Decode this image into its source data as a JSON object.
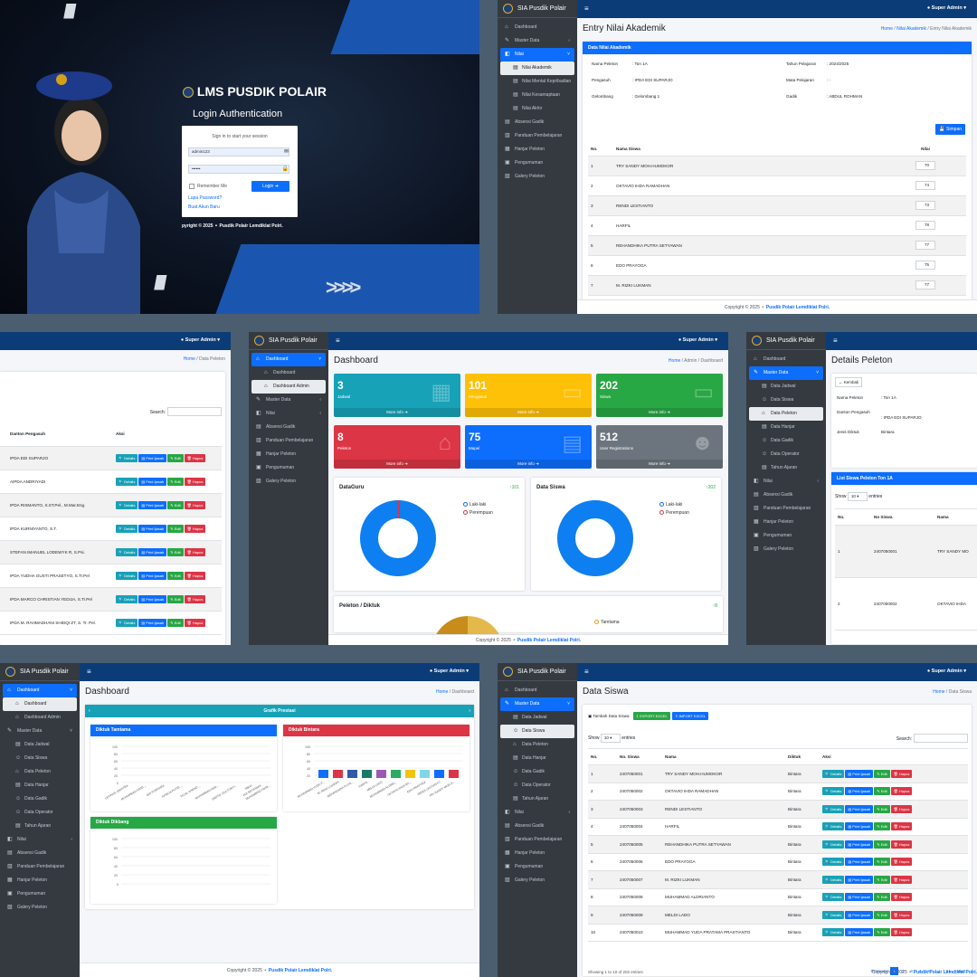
{
  "login": {
    "brand": "LMS PUSDIK POLAIR",
    "title": "Login Authentication",
    "prompt": "Sign in to start your session",
    "username": "admin123",
    "password": "••••••",
    "remember": "Remember Me",
    "login_btn": "Login",
    "forgot": "Lupa Password?",
    "register": "Buat Akun Baru",
    "copyright": "pyright © 2025 ⚬ Pusdik Polair Lemdiklat Polri."
  },
  "common": {
    "brand": "SIA Pusdik Polair",
    "user": "Super Admin",
    "home": "Home",
    "footer_pre": "Copyright © 2025 ⚬ ",
    "footer_org": "Pusdik Polair Lemdiklat Polri.",
    "search": "Search:",
    "show": "Show",
    "entries": "entries"
  },
  "entry": {
    "title": "Entry Nilai Akademik",
    "crumb_mid": "Nilai Akademik",
    "crumb_cur": "Entry Nilai Akademik",
    "header": "Data Nilai Akademik",
    "info": [
      [
        "Nama Peleton",
        ": Ton 1A",
        "Tahun Pelajaran",
        ": 2024/2025"
      ],
      [
        "Pengasuh",
        ": IPDA EDI SUPARJO",
        "Mata Pelajaran",
        ": -"
      ],
      [
        "Gelombang",
        ": Gelombang 1",
        "Gadik",
        ": ABDUL ROHMAN"
      ]
    ],
    "save": "Simpan",
    "cols": [
      "No.",
      "Nama Siswa",
      "Nilai"
    ],
    "rows": [
      [
        "1",
        "TRY SANDY MOH.HUMOKOR",
        "70"
      ],
      [
        "2",
        "OKTAVIO IHDA RAMADHAN",
        "74"
      ],
      [
        "3",
        "RENDI LESTIANTO",
        "73"
      ],
      [
        "4",
        "HARFIL",
        "78"
      ],
      [
        "5",
        "REHANDHIKA PUTRA SETYAWAN",
        "77"
      ],
      [
        "6",
        "EDO PRAYOGA",
        "75"
      ],
      [
        "7",
        "M. RIZKI LUKMAN",
        "77"
      ]
    ],
    "menu": [
      "Dashboard",
      "Master Data",
      "Nilai",
      "Nilai Akademik",
      "Nilai Mental Kepribadian",
      "Nilai Kesamaptaan",
      "Nilai Akhir",
      "Absensi Gadik",
      "Panduan Pembelajaran",
      "Hanjar Peleton",
      "Pengumuman",
      "Galery Peleton"
    ]
  },
  "peleton": {
    "crumb_cur": "Data Peleton",
    "col": "Danton Pengasuh",
    "aksi": "Aksi",
    "rows": [
      "IPDA EDI SUPARJO",
      "AIPDA ANDRIYADI",
      "IPDA RISMANTO, S.ST.Pel., M.Mar.Eng.",
      "IPDA KURNIYANTO, S.T.",
      "STEFAN IMANUEL LODEWYK R, S.Psi.",
      "IPDA YUDHA GUSTI PRASETYO, S.Tr.Pel",
      "IPDA MARCO CHRISTIAN YEDIJA, S.Tr.Pel",
      "IPDA M. RAHMADHANI SHIDQI ZT, S. Tr. Pel."
    ],
    "btns": [
      "Details",
      "Print Ijasah",
      "Edit",
      "Hapus"
    ]
  },
  "dash": {
    "title": "Dashboard",
    "crumb_mid": "Admin",
    "crumb_cur": "Dashboard",
    "menu": [
      "Dashboard",
      "Dashboard",
      "Dashboard Admin",
      "Master Data",
      "Nilai",
      "Absensi Gadik",
      "Panduan Pembelajaran",
      "Hanjar Peleton",
      "Pengumuman",
      "Galery Peleton"
    ],
    "boxes": [
      {
        "n": "3",
        "l": "Jadwal",
        "c": "#17a2b8"
      },
      {
        "n": "101",
        "l": "Pengasuh",
        "c": "#ffc107"
      },
      {
        "n": "202",
        "l": "Siswa",
        "c": "#28a745"
      },
      {
        "n": "8",
        "l": "Peleton",
        "c": "#dc3545"
      },
      {
        "n": "75",
        "l": "Mapel",
        "c": "#0d6efd"
      },
      {
        "n": "512",
        "l": "User Registrations",
        "c": "#6c757d"
      }
    ],
    "more": "More info",
    "guru": {
      "title": "DataGuru",
      "count": "101",
      "l1": "Laki-laki",
      "l2": "Perempuan"
    },
    "siswa": {
      "title": "Data Siswa",
      "count": "202",
      "l1": "Laki-laki",
      "l2": "Perempuan"
    },
    "pel": {
      "title": "Peleton / Diktuk",
      "count": "8",
      "l1": "Tamtama"
    }
  },
  "detail": {
    "title": "Details Peleton",
    "back": "Kembali",
    "info": [
      [
        "Nama Peleton",
        ": Ton 1A"
      ],
      [
        "Danton Pengasuh",
        ": IPDA EDI SUPARJO"
      ],
      [
        "Jenis Diktuk",
        "Bintara"
      ]
    ],
    "list": "List Siswa Peleton Ton 1A",
    "cols": [
      "No.",
      "No Siswa",
      "Nama"
    ],
    "rows": [
      [
        "1",
        "2407050001",
        "TRY SANDY MO"
      ],
      [
        "2",
        "2407050002",
        "OKTAVIO IHDA"
      ]
    ],
    "menu": [
      "Dashboard",
      "Master Data",
      "Data Jadwal",
      "Data Siswa",
      "Data Peleton",
      "Data Hanjar",
      "Data Gadik",
      "Data Operator",
      "Tahun Ajaran",
      "Nilai",
      "Absensi Gadik",
      "Panduan Pembelajaran",
      "Hanjar Peleton",
      "Pengumuman",
      "Galery Peleton"
    ]
  },
  "dash2": {
    "title": "Dashboard",
    "crumb_cur": "Dashboard",
    "grafik": "Grafik Prestasi",
    "c1": "Diktuk Tamtama",
    "c2": "Diktuk Bintara",
    "c3": "Diktuk Dikbang",
    "menu": [
      "Dashboard",
      "Dashboard",
      "Dashboard Admin",
      "Master Data",
      "Data Jadwal",
      "Data Siswa",
      "Data Peleton",
      "Data Hanjar",
      "Data Gadik",
      "Data Operator",
      "Tahun Ajaran",
      "Nilai",
      "Absensi Gadik",
      "Panduan Pembelajaran",
      "Hanjar Peleton",
      "Pengumuman",
      "Galery Peleton"
    ]
  },
  "siswa": {
    "title": "Data Siswa",
    "crumb_cur": "Data Siswa",
    "add": "Tambah Data Siswa",
    "export": "EXPORT EXCEL",
    "import": "IMPORT EXCEL",
    "cols": [
      "No.",
      "No. Siswa",
      "Nama",
      "Diktuk",
      "Aksi"
    ],
    "rows": [
      [
        "1",
        "2407050001",
        "TRY SANDY MOH.HUMOKOR",
        "Bintara"
      ],
      [
        "2",
        "2407050002",
        "OKTAVIO IHDA RAMADHAN",
        "Bintara"
      ],
      [
        "3",
        "2407050003",
        "RENDI LESTIANTO",
        "Bintara"
      ],
      [
        "4",
        "2407050004",
        "HARFIL",
        "Bintara"
      ],
      [
        "5",
        "2407050005",
        "REHANDHIKA PUTRA SETYAWAN",
        "Bintara"
      ],
      [
        "6",
        "2407050006",
        "EDO PRAYOGA",
        "Bintara"
      ],
      [
        "7",
        "2407050007",
        "M. RIZKI LUKMAN",
        "Bintara"
      ],
      [
        "8",
        "2407050008",
        "MUHAMMAD ALDRIANTO",
        "Bintara"
      ],
      [
        "9",
        "2407050009",
        "MELDI LADO",
        "Bintara"
      ],
      [
        "10",
        "2407050010",
        "MUHAMMAD YUDA PRATAMA PRASTIANTO",
        "Bintara"
      ]
    ],
    "showing": "Showing 1 to 10 of 202 entries",
    "pages": [
      "Previous",
      "1",
      "2",
      "3",
      "4",
      "5",
      "...",
      "21",
      "Next"
    ],
    "menu": [
      "Dashboard",
      "Master Data",
      "Data Jadwal",
      "Data Siswa",
      "Data Peleton",
      "Data Hanjar",
      "Data Gadik",
      "Data Operator",
      "Tahun Ajaran",
      "Nilai",
      "Absensi Gadik",
      "Panduan Pembelajaran",
      "Hanjar Peleton",
      "Pengumuman",
      "Galery Peleton"
    ]
  }
}
